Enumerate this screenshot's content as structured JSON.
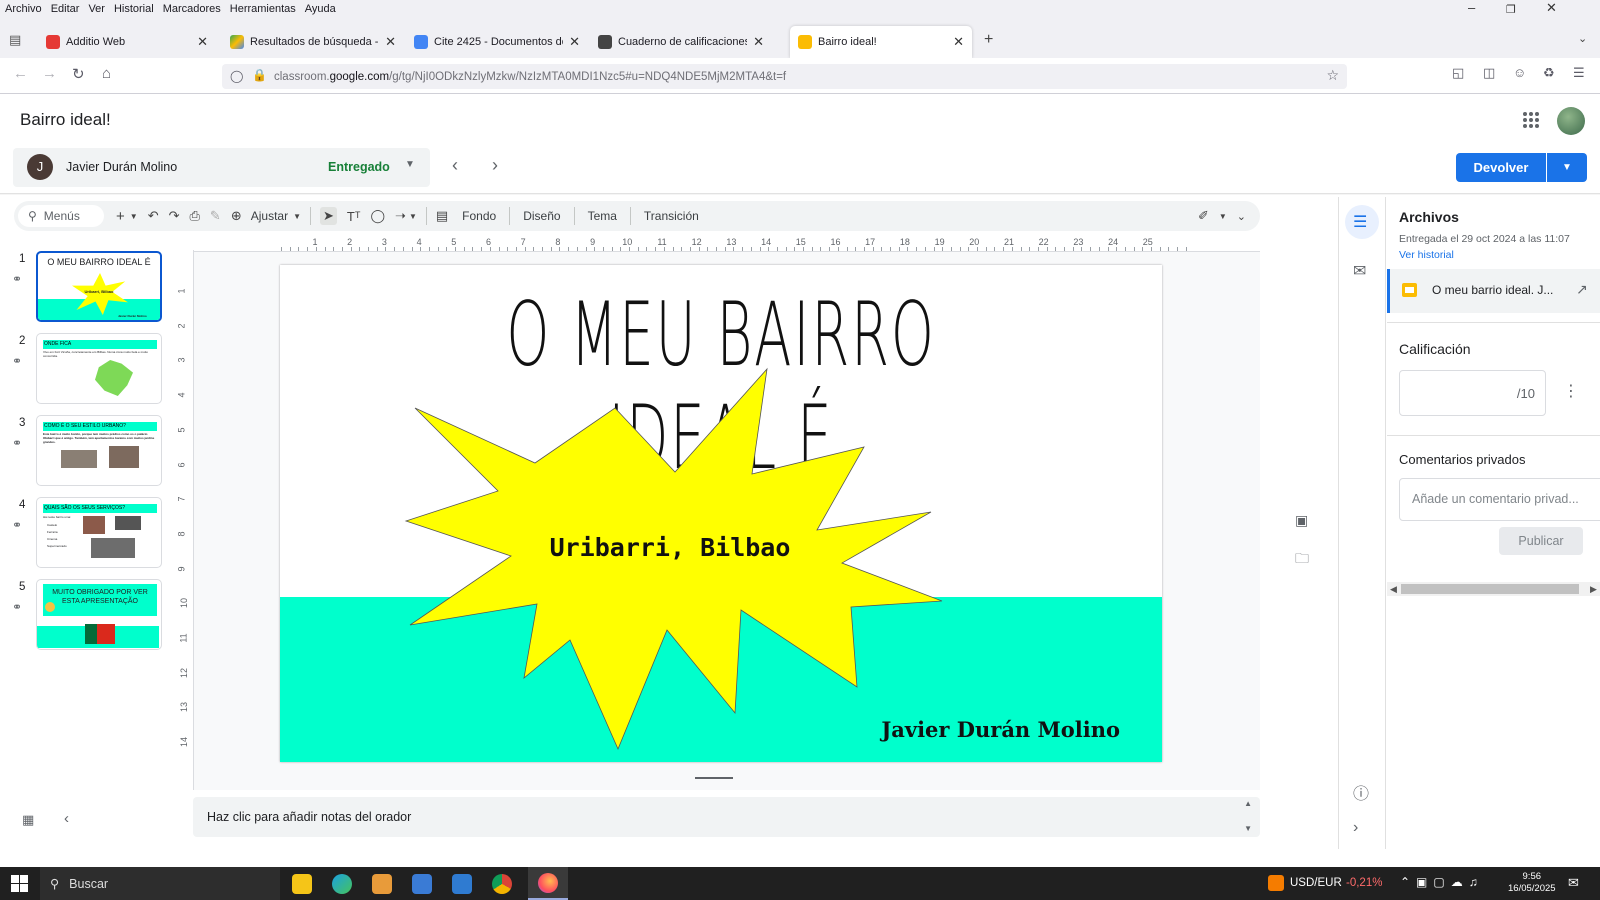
{
  "browser": {
    "menu": [
      "Archivo",
      "Editar",
      "Ver",
      "Historial",
      "Marcadores",
      "Herramientas",
      "Ayuda"
    ],
    "tabs": [
      {
        "label": "Additio Web",
        "color": "#e53935"
      },
      {
        "label": "Resultados de búsqueda - Goog",
        "color": "#34a853"
      },
      {
        "label": "Cite 2425 - Documentos de Goo",
        "color": "#4285f4"
      },
      {
        "label": "Cuaderno de calificaciones de 2",
        "color": "#444444"
      },
      {
        "label": "Bairro ideal!",
        "color": "#fbbc04"
      }
    ],
    "url_prefix": "classroom.",
    "url_domain": "google.com",
    "url_rest": "/g/tg/NjI0ODkzNzlyMzkw/NzIzMTA0MDI1Nzc5#u=NDQ4NDE5MjM2MTA4&t=f"
  },
  "classroom": {
    "title": "Bairro ideal!",
    "student_initial": "J",
    "student_name": "Javier Durán Molino",
    "status": "Entregado",
    "return_label": "Devolver"
  },
  "toolbar": {
    "search": "Menús",
    "zoom": "Ajustar",
    "items": [
      "Fondo",
      "Diseño",
      "Tema",
      "Transición"
    ]
  },
  "ruler_top": [
    "1",
    "2",
    "3",
    "4",
    "5",
    "6",
    "7",
    "8",
    "9",
    "10",
    "11",
    "12",
    "13",
    "14",
    "15",
    "16",
    "17",
    "18",
    "19",
    "20",
    "21",
    "22",
    "23",
    "24",
    "25"
  ],
  "ruler_left": [
    "1",
    "2",
    "3",
    "4",
    "5",
    "6",
    "7",
    "8",
    "9",
    "10",
    "11",
    "12",
    "13",
    "14"
  ],
  "slides": [
    {
      "num": "1",
      "title": "O MEU BAIRRO IDEAL É",
      "sub": "Uribarri, Bilbao",
      "author": "Javier Durán Molino"
    },
    {
      "num": "2",
      "title": "ONDE FICA",
      "text": "Vivo em Fort Vicuña, concretamente em Bilbao. Numa zona muito bela e muito concorrida."
    },
    {
      "num": "3",
      "title": "COMO É O SEU ESTILO URBANO?",
      "text": "Este bairro é muito bonito, porque tem muitos prédios como os o palácio Olábarri que é antigo. Também, tem apartamentos baratos com muitos jardins grandes."
    },
    {
      "num": "4",
      "title": "QUAIS SÃO OS SEUS SERVIÇOS?",
      "text": "Há neste bairro uma:",
      "bullets": [
        "Castelo",
        "Ferraria",
        "Cinema",
        "Supermercado"
      ]
    },
    {
      "num": "5",
      "title": "MUITO OBRIGADO POR VER ESTA APRESENTAÇÃO"
    }
  ],
  "notes_placeholder": "Haz clic para añadir notas del orador",
  "panel": {
    "files_title": "Archivos",
    "delivered": "Entregada el 29 oct 2024 a las 11:07",
    "history": "Ver historial",
    "file_name": "O meu barrio ideal. J...",
    "grade_label": "Calificación",
    "grade_denominator": "/10",
    "comments_label": "Comentarios privados",
    "comments_placeholder": "Añade un comentario privad...",
    "publish": "Publicar"
  },
  "taskbar": {
    "search": "Buscar",
    "currency": "USD/EUR",
    "currency_change": "-0,21%",
    "time": "9:56",
    "date": "16/05/2025"
  },
  "colors": {
    "accent": "#1a73e8",
    "slide_band": "#00ffcc",
    "star": "#ffff00",
    "status_green": "#188038"
  }
}
